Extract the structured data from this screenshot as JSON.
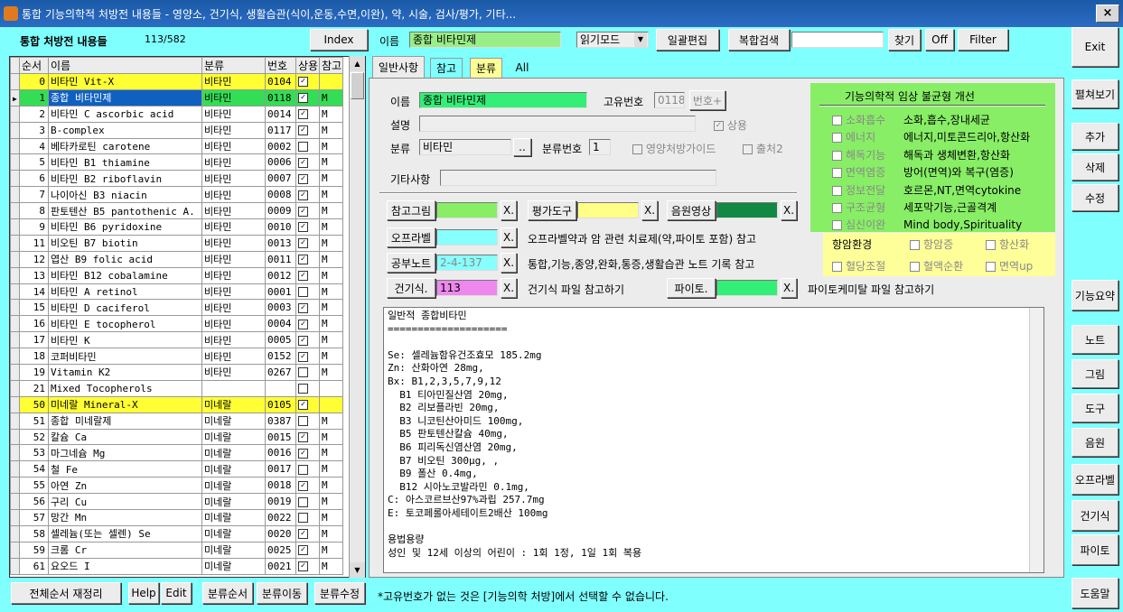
{
  "window": {
    "title": "통합 기능의학적 처방전 내용들 - 영양소, 건기식, 생활습관(식이,운동,수면,이완), 약, 시술, 검사/평가, 기타...",
    "close": "×"
  },
  "header": {
    "title": "통합 처방전 내용들",
    "count": "113/582",
    "index_btn": "Index",
    "name_label": "이름",
    "name_value": "종합 비타민제",
    "mode": "읽기모드",
    "bulk_edit": "일괄편집",
    "complex_search": "복합검색",
    "search_value": "",
    "find": "찾기",
    "off": "Off",
    "filter": "Filter"
  },
  "grid": {
    "columns": [
      "순서",
      "이름",
      "분류",
      "번호",
      "상용",
      "참고"
    ],
    "rows": [
      {
        "n": "0",
        "name": "비타민 Vit-X",
        "cat": "비타민",
        "no": "0104",
        "use": true,
        "ref": "",
        "style": "y"
      },
      {
        "n": "1",
        "name": "종합 비타민제",
        "cat": "비타민",
        "no": "0118",
        "use": true,
        "ref": "M",
        "style": "g",
        "sel": true
      },
      {
        "n": "2",
        "name": "비타민 C ascorbic acid",
        "cat": "비타민",
        "no": "0014",
        "use": true,
        "ref": "M"
      },
      {
        "n": "3",
        "name": "B-complex",
        "cat": "비타민",
        "no": "0117",
        "use": true,
        "ref": "M"
      },
      {
        "n": "4",
        "name": "베타카로틴 carotene",
        "cat": "비타민",
        "no": "0002",
        "use": false,
        "ref": "M"
      },
      {
        "n": "5",
        "name": "비타민 B1 thiamine",
        "cat": "비타민",
        "no": "0006",
        "use": true,
        "ref": "M"
      },
      {
        "n": "6",
        "name": "비타민 B2 riboflavin",
        "cat": "비타민",
        "no": "0007",
        "use": true,
        "ref": "M"
      },
      {
        "n": "7",
        "name": "나이아신 B3 niacin",
        "cat": "비타민",
        "no": "0008",
        "use": true,
        "ref": "M"
      },
      {
        "n": "8",
        "name": "판토텐산 B5 pantothenic A.",
        "cat": "비타민",
        "no": "0009",
        "use": true,
        "ref": "M"
      },
      {
        "n": "9",
        "name": "비타민 B6 pyridoxine",
        "cat": "비타민",
        "no": "0010",
        "use": true,
        "ref": "M"
      },
      {
        "n": "11",
        "name": "비오틴 B7 biotin",
        "cat": "비타민",
        "no": "0013",
        "use": true,
        "ref": "M"
      },
      {
        "n": "12",
        "name": "엽산 B9 folic acid",
        "cat": "비타민",
        "no": "0011",
        "use": true,
        "ref": "M"
      },
      {
        "n": "13",
        "name": "비타민 B12 cobalamine",
        "cat": "비타민",
        "no": "0012",
        "use": true,
        "ref": "M"
      },
      {
        "n": "14",
        "name": "비타민 A retinol",
        "cat": "비타민",
        "no": "0001",
        "use": false,
        "ref": "M"
      },
      {
        "n": "15",
        "name": "비타민 D caciferol",
        "cat": "비타민",
        "no": "0003",
        "use": true,
        "ref": "M"
      },
      {
        "n": "16",
        "name": "비타민 E tocopherol",
        "cat": "비타민",
        "no": "0004",
        "use": true,
        "ref": "M"
      },
      {
        "n": "17",
        "name": "비타민 K",
        "cat": "비타민",
        "no": "0005",
        "use": true,
        "ref": "M"
      },
      {
        "n": "18",
        "name": "코퍼비타민",
        "cat": "비타민",
        "no": "0152",
        "use": true,
        "ref": "M"
      },
      {
        "n": "19",
        "name": "Vitamin K2",
        "cat": "비타민",
        "no": "0267",
        "use": false,
        "ref": "M"
      },
      {
        "n": "21",
        "name": "Mixed Tocopherols",
        "cat": "",
        "no": "",
        "use": false,
        "ref": ""
      },
      {
        "n": "50",
        "name": "미네랄 Mineral-X",
        "cat": "미네랄",
        "no": "0105",
        "use": true,
        "ref": "",
        "style": "y"
      },
      {
        "n": "51",
        "name": "종합 미네랄제",
        "cat": "미네랄",
        "no": "0387",
        "use": false,
        "ref": "M"
      },
      {
        "n": "52",
        "name": "칼슘 Ca",
        "cat": "미네랄",
        "no": "0015",
        "use": true,
        "ref": "M"
      },
      {
        "n": "53",
        "name": "마그네슘 Mg",
        "cat": "미네랄",
        "no": "0016",
        "use": true,
        "ref": "M"
      },
      {
        "n": "54",
        "name": "철 Fe",
        "cat": "미네랄",
        "no": "0017",
        "use": false,
        "ref": "M"
      },
      {
        "n": "55",
        "name": "아연 Zn",
        "cat": "미네랄",
        "no": "0018",
        "use": true,
        "ref": "M"
      },
      {
        "n": "56",
        "name": "구리 Cu",
        "cat": "미네랄",
        "no": "0019",
        "use": false,
        "ref": "M"
      },
      {
        "n": "57",
        "name": "망간 Mn",
        "cat": "미네랄",
        "no": "0022",
        "use": false,
        "ref": "M"
      },
      {
        "n": "58",
        "name": "셀레늄(또는 셀렌) Se",
        "cat": "미네랄",
        "no": "0020",
        "use": true,
        "ref": "M"
      },
      {
        "n": "59",
        "name": "크롬 Cr",
        "cat": "미네랄",
        "no": "0025",
        "use": true,
        "ref": "M"
      },
      {
        "n": "61",
        "name": "요오드 I",
        "cat": "미네랄",
        "no": "0021",
        "use": true,
        "ref": "M"
      }
    ]
  },
  "bottom_left": {
    "reorder": "전체순서 재정리",
    "help": "Help",
    "edit": "Edit",
    "cat_order": "분류순서",
    "cat_move": "분류이동",
    "cat_edit": "분류수정"
  },
  "tabs": [
    "일반사항",
    "참고",
    "분류",
    "All"
  ],
  "form": {
    "name_label": "이름",
    "name_value": "종합 비타민제",
    "uid_label": "고유번호",
    "uid_value": "0118",
    "uid_btn": "번호+",
    "desc_label": "설명",
    "desc_value": "",
    "common": "상용",
    "cat_label": "분류",
    "cat_value": "비타민",
    "cat_btn": "..",
    "catno_label": "분류번호",
    "catno_value": "1",
    "guide": "영양처방가이드",
    "out2": "출처2",
    "etc_label": "기타사항",
    "etc_value": "",
    "ref_img": "참고그림",
    "eval_tool": "평가도구",
    "audio": "음원영상",
    "x": "X.",
    "oprabel": "오프라벨",
    "oprabel_desc": "오프라벨약과 암 관련 치료제(약,파이토 포함) 참고",
    "study": "공부노트",
    "study_value": "2-4-137",
    "study_desc": "통합,기능,종양,완화,통증,생활습관 노트 기록 참고",
    "hf": "건기식.",
    "hf_value": "113",
    "hf_desc": "건기식 파일 참고하기",
    "phyto": "파이토.",
    "phyto_desc": "파이토케미탈 파일 참고하기"
  },
  "imbalance": {
    "title": "기능의학적 임상 불균형 개선",
    "items": [
      {
        "k": "소화흡수",
        "v": "소화,흡수,장내세균"
      },
      {
        "k": "에너지",
        "v": "에너지,미토콘드리아,항산화"
      },
      {
        "k": "해독기능",
        "v": "해독과 생체변환,항산화"
      },
      {
        "k": "면역염증",
        "v": "방어(면역)와 복구(염증)"
      },
      {
        "k": "정보전달",
        "v": "호르몬,NT,면역cytokine"
      },
      {
        "k": "구조균형",
        "v": "세포막기능,근골격계"
      },
      {
        "k": "심신이완",
        "v": "Mind body,Spirituality"
      }
    ]
  },
  "anticancer": {
    "title": "항암환경",
    "items": [
      "항암증",
      "항산화",
      "혈당조절",
      "혈액순환",
      "면역up"
    ]
  },
  "memo": "일반적 종합비타민\n====================\n\nSe: 셀레늄함유건조효모 185.2mg\nZn: 산화아연 28mg,\nBx: B1,2,3,5,7,9,12\n  B1 티아민질산염 20mg,\n  B2 리보플라빈 20mg,\n  B3 니코틴산아미드 100mg,\n  B5 판토텐산칼슘 40mg,\n  B6 피리독신염산염 20mg,\n  B7 비오틴 300μg, ,\n  B9 폴산 0.4mg,\n  B12 시아노코발라민 0.1mg,\nC: 아스코르브산97%과립 257.7mg\nE: 토코페롤아세테이트2배산 100mg\n\n용법용량\n성인 및 12세 이상의 어린이 : 1회 1정, 1일 1회 복용",
  "status": "*고유번호가 없는 것은 [기능의학 처방]에서 선택할 수 없습니다.",
  "right_buttons": {
    "exit": "Exit",
    "expand": "펼쳐보기",
    "add": "추가",
    "del": "삭제",
    "mod": "수정",
    "summary": "기능요약",
    "note": "노트",
    "pic": "그림",
    "tool": "도구",
    "audio": "음원",
    "oprabel": "오프라벨",
    "hf": "건기식",
    "phyto": "파이토",
    "help": "도움말"
  },
  "colors": {
    "titlebar": "#1a5aa6",
    "bg": "#80ffff",
    "yellow": "#ffff33",
    "green": "#33dd55",
    "select": "#1060c0"
  }
}
